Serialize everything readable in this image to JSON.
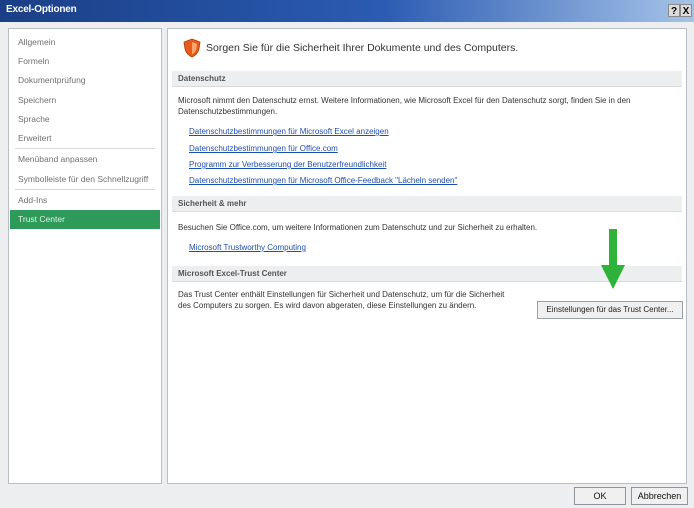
{
  "window": {
    "title": "Excel-Optionen",
    "help_button": "?",
    "close_button": "X"
  },
  "sidebar": {
    "items": [
      {
        "label": "Allgemein"
      },
      {
        "label": "Formeln"
      },
      {
        "label": "Dokumentprüfung"
      },
      {
        "label": "Speichern"
      },
      {
        "label": "Sprache"
      },
      {
        "label": "Erweitert"
      },
      {
        "label": "Menüband anpassen"
      },
      {
        "label": "Symbolleiste für den Schnellzugriff"
      },
      {
        "label": "Add-Ins"
      },
      {
        "label": "Trust Center"
      }
    ],
    "selected": "Trust Center",
    "accent_color": "#2e9a5a"
  },
  "main": {
    "heading": "Sorgen Sie für die Sicherheit Ihrer Dokumente und des Computers.",
    "heading_icon": "shield-icon",
    "sections": {
      "datenschutz": {
        "title": "Datenschutz",
        "text": "Microsoft nimmt den Datenschutz ernst. Weitere Informationen, wie Microsoft Excel für den Datenschutz sorgt, finden Sie in den Datenschutzbestimmungen.",
        "links": [
          "Datenschutzbestimmungen für Microsoft Excel anzeigen",
          "Datenschutzbestimmungen für Office.com",
          "Programm zur Verbesserung der Benutzerfreundlichkeit",
          "Datenschutzbestimmungen für Microsoft Office-Feedback \"Lächeln senden\""
        ]
      },
      "sicherheit": {
        "title": "Sicherheit & mehr",
        "text": "Besuchen Sie Office.com, um weitere Informationen zum Datenschutz und zur Sicherheit zu erhalten.",
        "link": "Microsoft Trustworthy Computing"
      },
      "trust_center": {
        "title": "Microsoft Excel-Trust Center",
        "text": "Das Trust Center enthält Einstellungen für Sicherheit und Datenschutz, um für die Sicherheit des Computers zu sorgen. Es wird davon abgeraten, diese Einstellungen zu ändern.",
        "button": "Einstellungen für das Trust Center..."
      }
    },
    "annotation_arrow_color": "#2fb23a"
  },
  "footer": {
    "ok": "OK",
    "cancel": "Abbrechen"
  }
}
